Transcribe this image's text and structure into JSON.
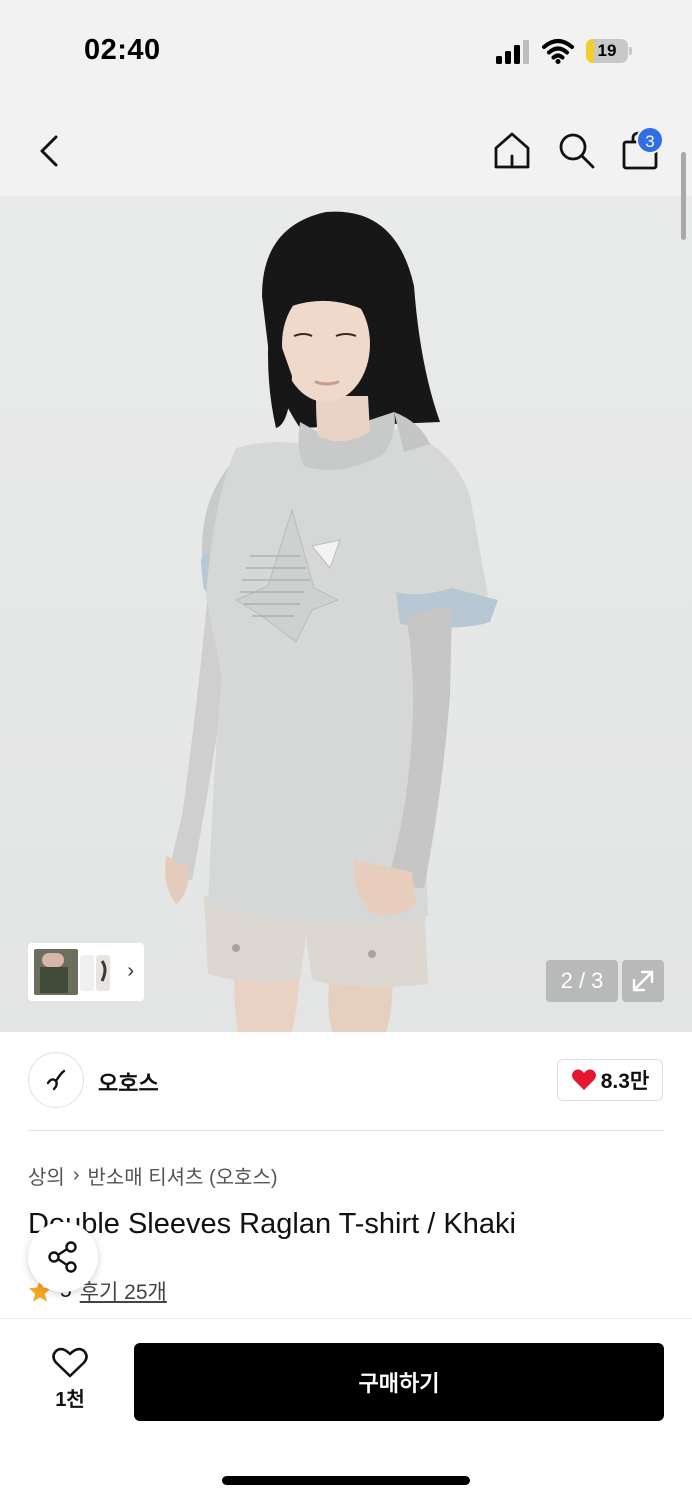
{
  "status_bar": {
    "time": "02:40",
    "battery": "19",
    "battery_level": 0.19
  },
  "nav": {
    "cart_count": "3"
  },
  "gallery": {
    "counter": "2 / 3",
    "current": 2,
    "total": 3
  },
  "brand": {
    "name": "오호스",
    "likes": "8.3만"
  },
  "product": {
    "breadcrumb": [
      "상의",
      "반소매 티셔츠 (오호스)"
    ],
    "title": "Double Sleeves Raglan T-shirt / Khaki",
    "rating": "5",
    "reviews": "후기 25개"
  },
  "bottom": {
    "wish_count": "1천",
    "buy_label": "구매하기"
  },
  "colors": {
    "accent_blue": "#2f6ee8",
    "heart_red": "#e5172f",
    "star_orange": "#f5a623",
    "buy_black": "#000000"
  },
  "icons": [
    "back-icon",
    "home-icon",
    "search-icon",
    "bag-icon",
    "expand-icon",
    "heart-icon",
    "star-icon",
    "share-icon",
    "chevron-right-icon"
  ]
}
